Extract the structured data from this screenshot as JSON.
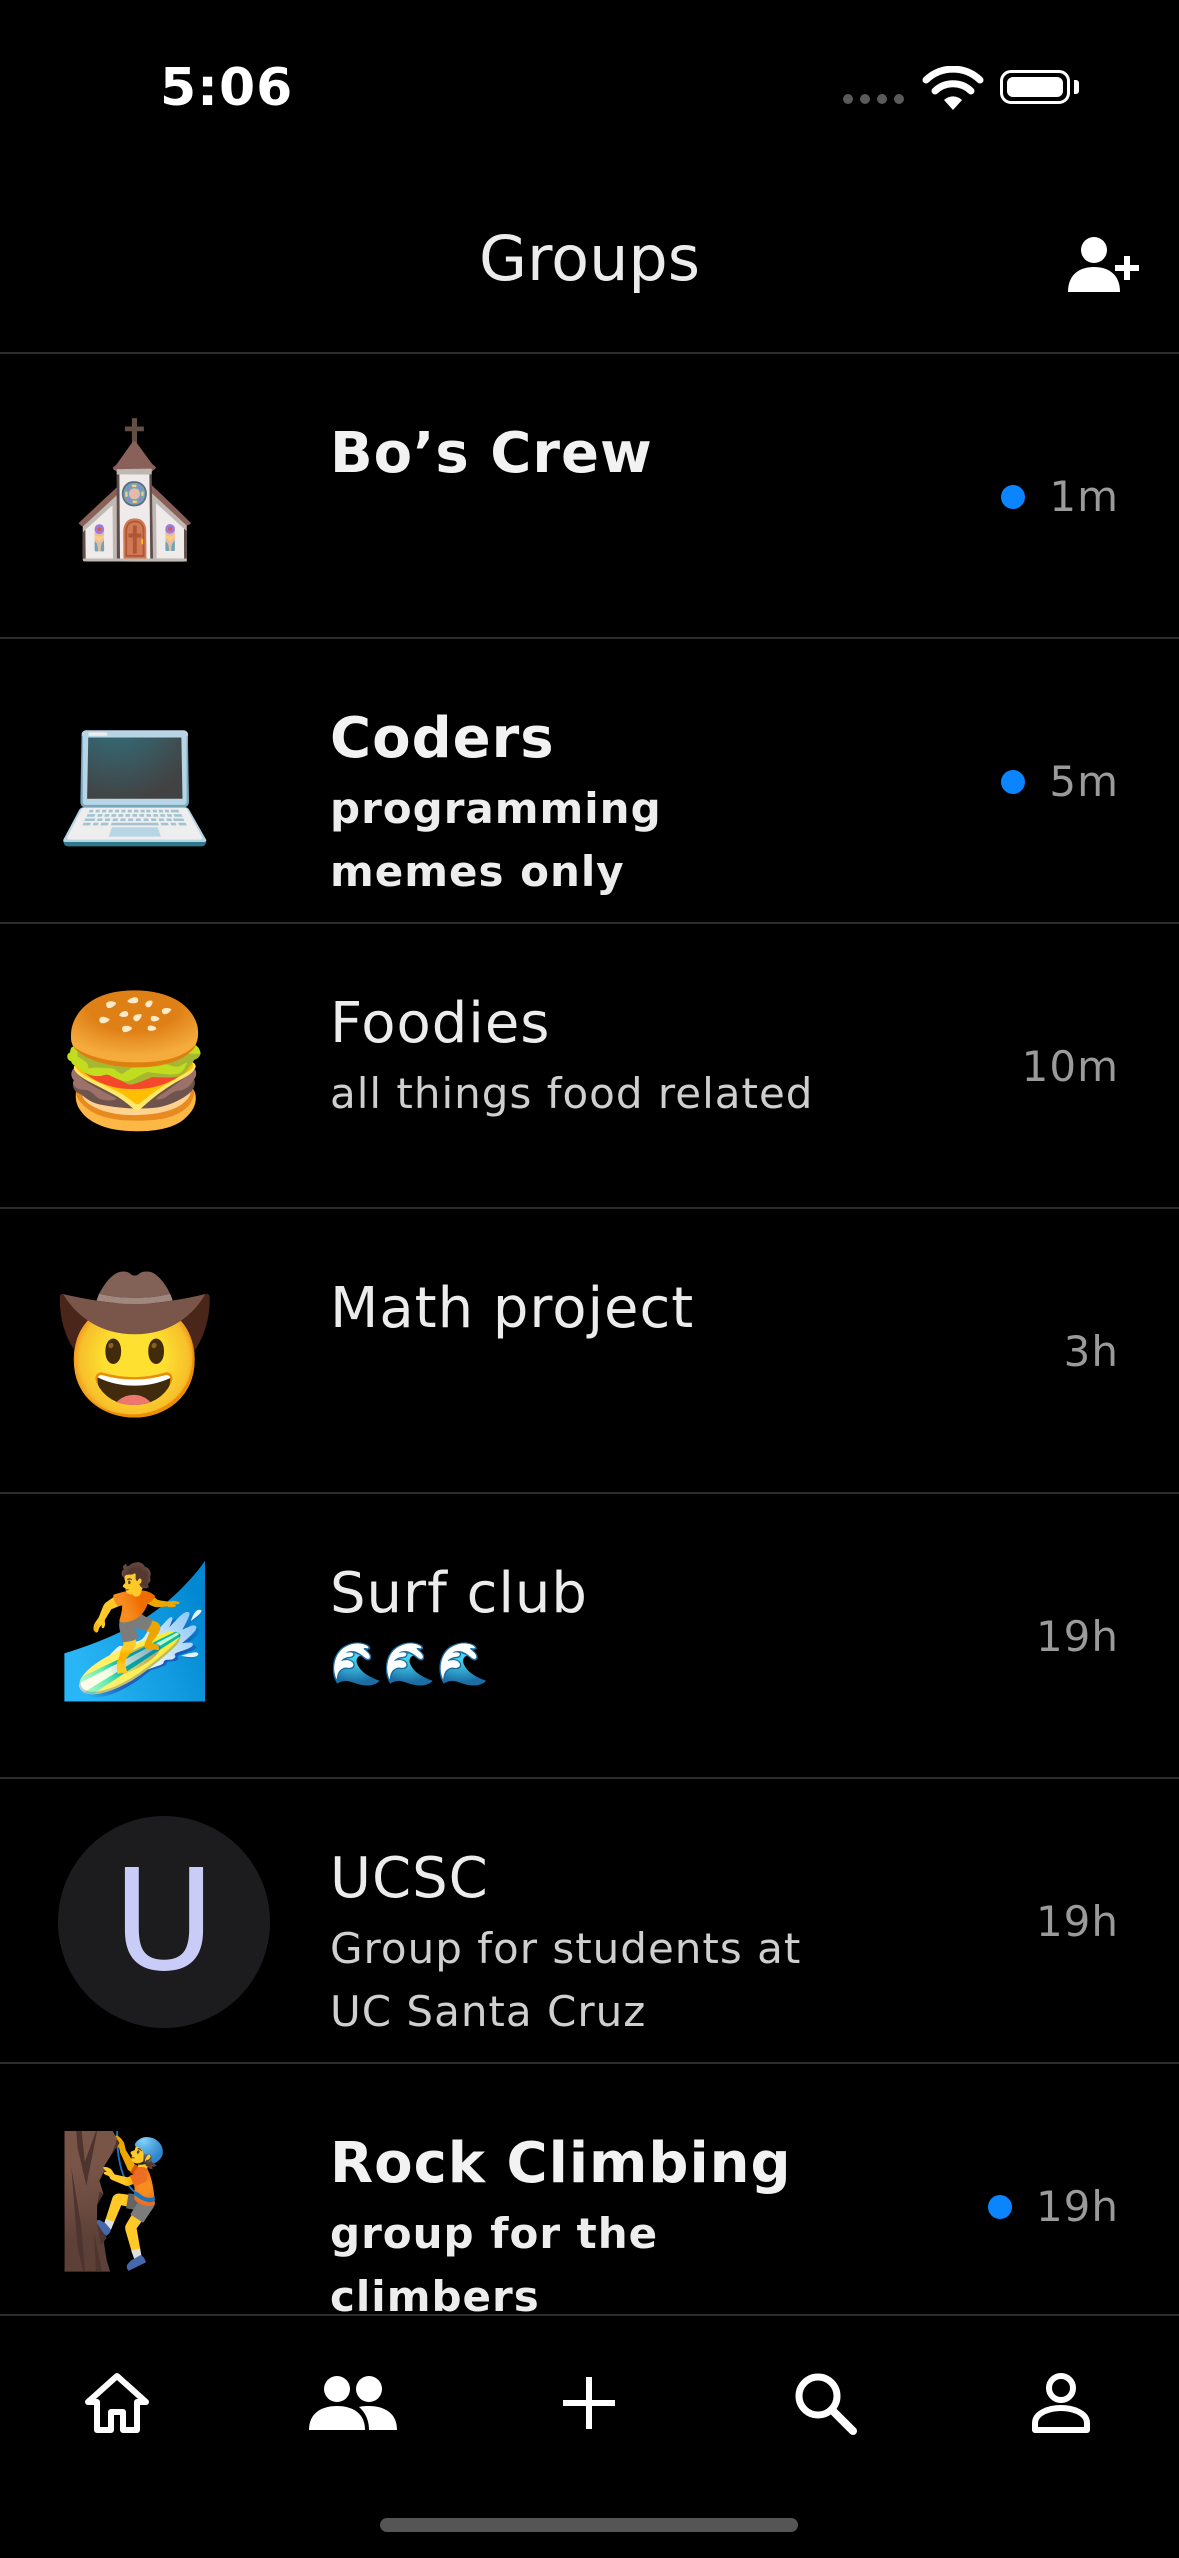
{
  "status_bar": {
    "time": "5:06"
  },
  "header": {
    "title": "Groups",
    "add_icon": "person-add-icon"
  },
  "groups": [
    {
      "avatar": "⛪",
      "name": "Bo’s Crew",
      "desc": "",
      "time": "1m",
      "unread": true
    },
    {
      "avatar": "💻",
      "name": "Coders",
      "desc": "programming memes only",
      "time": "5m",
      "unread": true
    },
    {
      "avatar": "🍔",
      "name": "Foodies",
      "desc": "all things food related",
      "time": "10m",
      "unread": false
    },
    {
      "avatar": "🤠",
      "name": "Math project",
      "desc": "",
      "time": "3h",
      "unread": false
    },
    {
      "avatar": "🏄",
      "name": "Surf club",
      "desc": "🌊🌊🌊",
      "time": "19h",
      "unread": false
    },
    {
      "avatar_letter": "U",
      "name": "UCSC",
      "desc": "Group for students at UC Santa Cruz",
      "time": "19h",
      "unread": false
    },
    {
      "avatar": "🧗",
      "name": "Rock Climbing",
      "desc": "group for the climbers",
      "time": "19h",
      "unread": true
    }
  ],
  "tab_bar": {
    "items": [
      "home-icon",
      "groups-icon",
      "plus-icon",
      "search-icon",
      "profile-icon"
    ],
    "active": "groups-icon"
  },
  "colors": {
    "unread": "#0a84ff",
    "background": "#000000",
    "divider": "#2c2c2e"
  }
}
